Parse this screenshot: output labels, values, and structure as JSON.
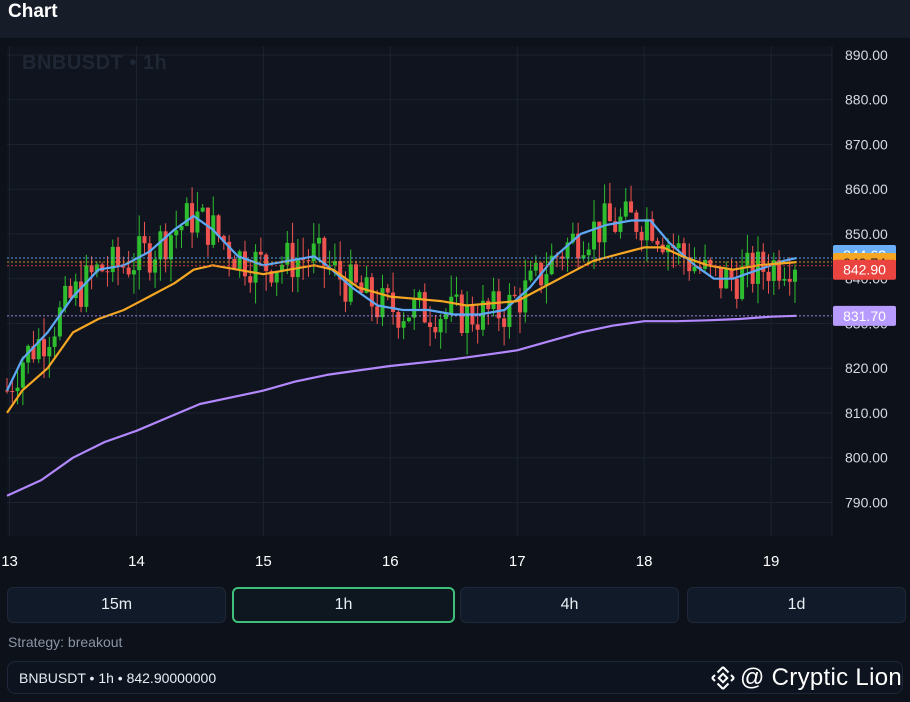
{
  "app": {
    "title": "Chart"
  },
  "symbol_watermark": "BNBUSDT • 1h",
  "timeframes": [
    {
      "label": "15m",
      "active": false
    },
    {
      "label": "1h",
      "active": true
    },
    {
      "label": "4h",
      "active": false
    },
    {
      "label": "1d",
      "active": false
    }
  ],
  "strategy_text": "Strategy: breakout",
  "status_text": "BNBUSDT • 1h • 842.90000000",
  "brand": {
    "text": "@ Cryptic Lion",
    "icon": "binance-logo-icon"
  },
  "colors": {
    "up": "#26a69a",
    "down": "#ef5350",
    "up_bright": "#2ebd2e",
    "ma_fast": "#5fa8f5",
    "ma_mid": "#f5a623",
    "ma_slow": "#b388ff",
    "tag_ma_fast": "#6aaef7",
    "tag_ma_mid": "#f5a623",
    "tag_last": "#e94440",
    "tag_ma_slow": "#b89bff"
  },
  "chart_data": {
    "type": "candlestick",
    "symbol": "BNBUSDT",
    "interval": "1h",
    "x_ticks": [
      "13",
      "14",
      "15",
      "16",
      "17",
      "18",
      "19"
    ],
    "y_ticks": [
      "890.00",
      "880.00",
      "870.00",
      "860.00",
      "850.00",
      "840.00",
      "830.00",
      "820.00",
      "810.00",
      "800.00",
      "790.00"
    ],
    "ylim": [
      782.5,
      892
    ],
    "x_range": [
      12.98,
      19.48
    ],
    "grid": true,
    "price_tags": [
      {
        "label": "844.62",
        "value": 844.62,
        "series": "ma_fast"
      },
      {
        "label": "843.74",
        "value": 843.74,
        "series": "ma_mid"
      },
      {
        "label": "842.90",
        "value": 842.9,
        "series": "last"
      },
      {
        "label": "831.70",
        "value": 831.7,
        "series": "ma_slow"
      }
    ],
    "series": [
      {
        "key": "ma_fast",
        "points": [
          [
            12.98,
            815
          ],
          [
            13.1,
            822
          ],
          [
            13.3,
            828
          ],
          [
            13.5,
            836
          ],
          [
            13.7,
            842
          ],
          [
            13.9,
            843
          ],
          [
            14.1,
            846
          ],
          [
            14.3,
            851
          ],
          [
            14.45,
            854
          ],
          [
            14.6,
            851
          ],
          [
            14.8,
            845
          ],
          [
            15,
            843
          ],
          [
            15.2,
            844
          ],
          [
            15.4,
            845
          ],
          [
            15.5,
            843
          ],
          [
            15.7,
            838
          ],
          [
            15.9,
            834
          ],
          [
            16.1,
            833
          ],
          [
            16.3,
            833
          ],
          [
            16.5,
            832
          ],
          [
            16.7,
            832
          ],
          [
            16.9,
            833
          ],
          [
            17.1,
            838
          ],
          [
            17.3,
            845
          ],
          [
            17.5,
            850
          ],
          [
            17.7,
            852
          ],
          [
            17.9,
            853
          ],
          [
            18.05,
            853
          ],
          [
            18.2,
            848
          ],
          [
            18.4,
            843
          ],
          [
            18.55,
            840
          ],
          [
            18.7,
            840
          ],
          [
            18.9,
            842
          ],
          [
            19.1,
            844
          ],
          [
            19.2,
            844.6
          ]
        ]
      },
      {
        "key": "ma_mid",
        "points": [
          [
            12.98,
            810
          ],
          [
            13.1,
            815
          ],
          [
            13.3,
            820
          ],
          [
            13.5,
            828
          ],
          [
            13.7,
            831
          ],
          [
            13.9,
            833
          ],
          [
            14.1,
            836
          ],
          [
            14.3,
            839
          ],
          [
            14.45,
            842
          ],
          [
            14.6,
            843
          ],
          [
            14.8,
            842
          ],
          [
            15,
            841
          ],
          [
            15.2,
            842
          ],
          [
            15.4,
            843
          ],
          [
            15.55,
            842
          ],
          [
            15.75,
            838
          ],
          [
            16,
            836
          ],
          [
            16.2,
            835.5
          ],
          [
            16.4,
            835
          ],
          [
            16.6,
            834
          ],
          [
            16.8,
            834.5
          ],
          [
            17,
            835
          ],
          [
            17.2,
            838
          ],
          [
            17.4,
            841
          ],
          [
            17.6,
            844
          ],
          [
            17.8,
            845.5
          ],
          [
            18,
            847
          ],
          [
            18.15,
            847
          ],
          [
            18.3,
            845
          ],
          [
            18.5,
            843
          ],
          [
            18.7,
            842
          ],
          [
            18.9,
            843
          ],
          [
            19.2,
            843.7
          ]
        ]
      },
      {
        "key": "ma_slow",
        "points": [
          [
            12.98,
            791.5
          ],
          [
            13.25,
            795
          ],
          [
            13.5,
            800
          ],
          [
            13.75,
            803.5
          ],
          [
            14,
            806
          ],
          [
            14.25,
            809
          ],
          [
            14.5,
            812
          ],
          [
            14.75,
            813.5
          ],
          [
            15,
            815
          ],
          [
            15.25,
            817
          ],
          [
            15.5,
            818.5
          ],
          [
            15.75,
            819.5
          ],
          [
            16,
            820.5
          ],
          [
            16.5,
            822
          ],
          [
            16.75,
            823
          ],
          [
            17,
            824
          ],
          [
            17.25,
            826
          ],
          [
            17.5,
            828
          ],
          [
            17.75,
            829.5
          ],
          [
            18,
            830.5
          ],
          [
            18.25,
            830.5
          ],
          [
            18.5,
            830.7
          ],
          [
            18.75,
            831
          ],
          [
            19,
            831.5
          ],
          [
            19.2,
            831.7
          ]
        ]
      }
    ]
  }
}
